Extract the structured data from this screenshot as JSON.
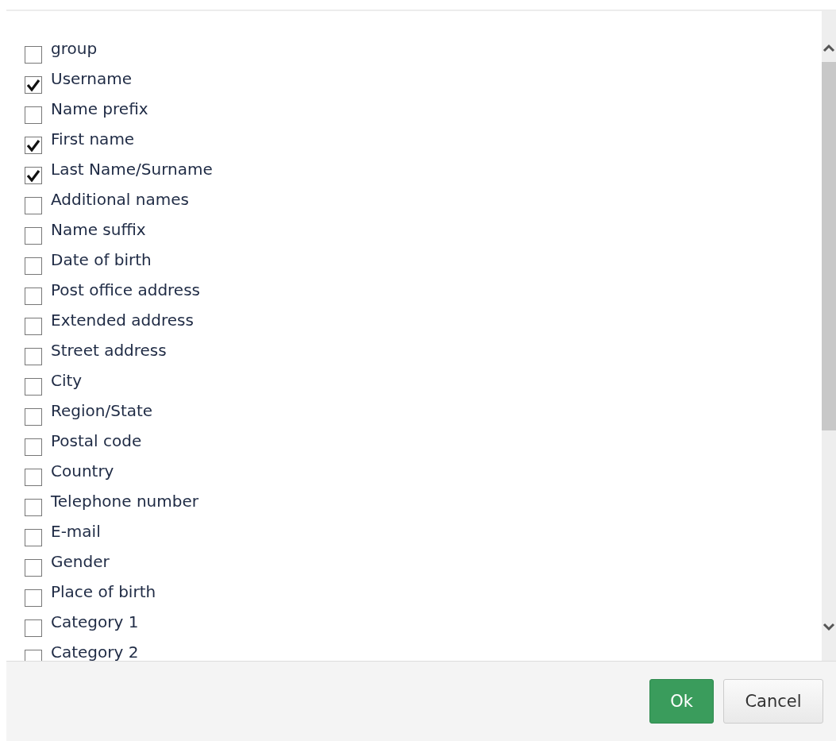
{
  "fields": [
    {
      "label": "group",
      "checked": false
    },
    {
      "label": "Username",
      "checked": true
    },
    {
      "label": "Name prefix",
      "checked": false
    },
    {
      "label": "First name",
      "checked": true
    },
    {
      "label": "Last Name/Surname",
      "checked": true
    },
    {
      "label": "Additional names",
      "checked": false
    },
    {
      "label": "Name suffix",
      "checked": false
    },
    {
      "label": "Date of birth",
      "checked": false
    },
    {
      "label": "Post office address",
      "checked": false
    },
    {
      "label": "Extended address",
      "checked": false
    },
    {
      "label": "Street address",
      "checked": false
    },
    {
      "label": "City",
      "checked": false
    },
    {
      "label": "Region/State",
      "checked": false
    },
    {
      "label": "Postal code",
      "checked": false
    },
    {
      "label": "Country",
      "checked": false
    },
    {
      "label": "Telephone number",
      "checked": false
    },
    {
      "label": "E-mail",
      "checked": false
    },
    {
      "label": "Gender",
      "checked": false
    },
    {
      "label": "Place of birth",
      "checked": false
    },
    {
      "label": "Category 1",
      "checked": false
    },
    {
      "label": "Category 2",
      "checked": false
    }
  ],
  "buttons": [
    {
      "label": "Ok",
      "kind": "primary"
    },
    {
      "label": "Cancel",
      "kind": "secondary"
    }
  ]
}
